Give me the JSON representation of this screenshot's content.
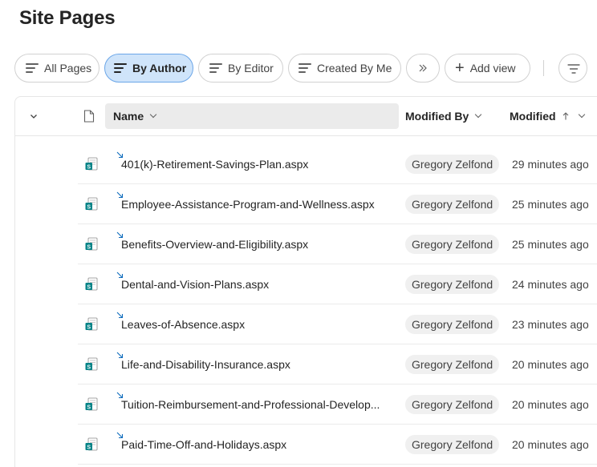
{
  "page": {
    "title": "Site Pages"
  },
  "views": {
    "tabs": [
      {
        "label": "All Pages",
        "active": false
      },
      {
        "label": "By Author",
        "active": true
      },
      {
        "label": "By Editor",
        "active": false
      },
      {
        "label": "Created By Me",
        "active": false
      }
    ],
    "add_view_label": "Add view"
  },
  "columns": {
    "name": "Name",
    "modified_by": "Modified By",
    "modified": "Modified",
    "sort_direction": "ascending"
  },
  "rows": [
    {
      "name": "401(k)-Retirement-Savings-Plan.aspx",
      "author": "Gregory Zelfond",
      "modified": "29 minutes ago"
    },
    {
      "name": "Employee-Assistance-Program-and-Wellness.aspx",
      "author": "Gregory Zelfond",
      "modified": "25 minutes ago"
    },
    {
      "name": "Benefits-Overview-and-Eligibility.aspx",
      "author": "Gregory Zelfond",
      "modified": "25 minutes ago"
    },
    {
      "name": "Dental-and-Vision-Plans.aspx",
      "author": "Gregory Zelfond",
      "modified": "24 minutes ago"
    },
    {
      "name": "Leaves-of-Absence.aspx",
      "author": "Gregory Zelfond",
      "modified": "23 minutes ago"
    },
    {
      "name": "Life-and-Disability-Insurance.aspx",
      "author": "Gregory Zelfond",
      "modified": "20 minutes ago"
    },
    {
      "name": "Tuition-Reimbursement-and-Professional-Develop...",
      "author": "Gregory Zelfond",
      "modified": "20 minutes ago"
    },
    {
      "name": "Paid-Time-Off-and-Holidays.aspx",
      "author": "Gregory Zelfond",
      "modified": "20 minutes ago"
    }
  ],
  "colors": {
    "accent": "#0f6cbd",
    "active_view_bg": "#cfe4fa",
    "sharepoint_icon": "#038387"
  }
}
